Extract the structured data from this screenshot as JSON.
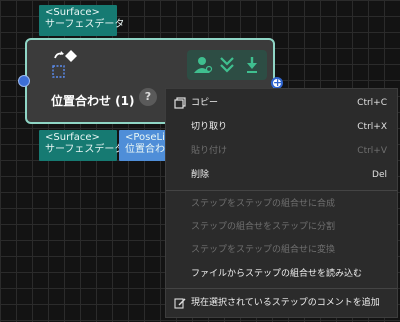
{
  "ports": {
    "top": {
      "line1": "<Surface>",
      "line2": "サーフェスデータ"
    },
    "bottom_left": {
      "line1": "<Surface>",
      "line2": "サーフェスデータ"
    },
    "bottom_right": {
      "line1": "<PoseLi",
      "line2": "位置合わ"
    }
  },
  "node": {
    "title": "位置合わせ (1)",
    "help": "?"
  },
  "colors": {
    "port_teal": "#167a72",
    "port_blue": "#4f8ed8",
    "node_border": "#8fd6c6",
    "status_green": "#3fbf8f"
  },
  "menu": {
    "copy": {
      "label": "コピー",
      "shortcut": "Ctrl+C"
    },
    "cut": {
      "label": "切り取り",
      "shortcut": "Ctrl+X"
    },
    "paste": {
      "label": "貼り付け",
      "shortcut": "Ctrl+V"
    },
    "delete": {
      "label": "削除",
      "shortcut": "Del"
    },
    "combine": {
      "label": "ステップをステップの組合せに合成"
    },
    "split": {
      "label": "ステップの組合せをステップに分割"
    },
    "convert": {
      "label": "ステップをステップの組合せに変換"
    },
    "load": {
      "label": "ファイルからステップの組合せを読み込む"
    },
    "comment": {
      "label": "現在選択されているステップのコメントを追加"
    }
  }
}
